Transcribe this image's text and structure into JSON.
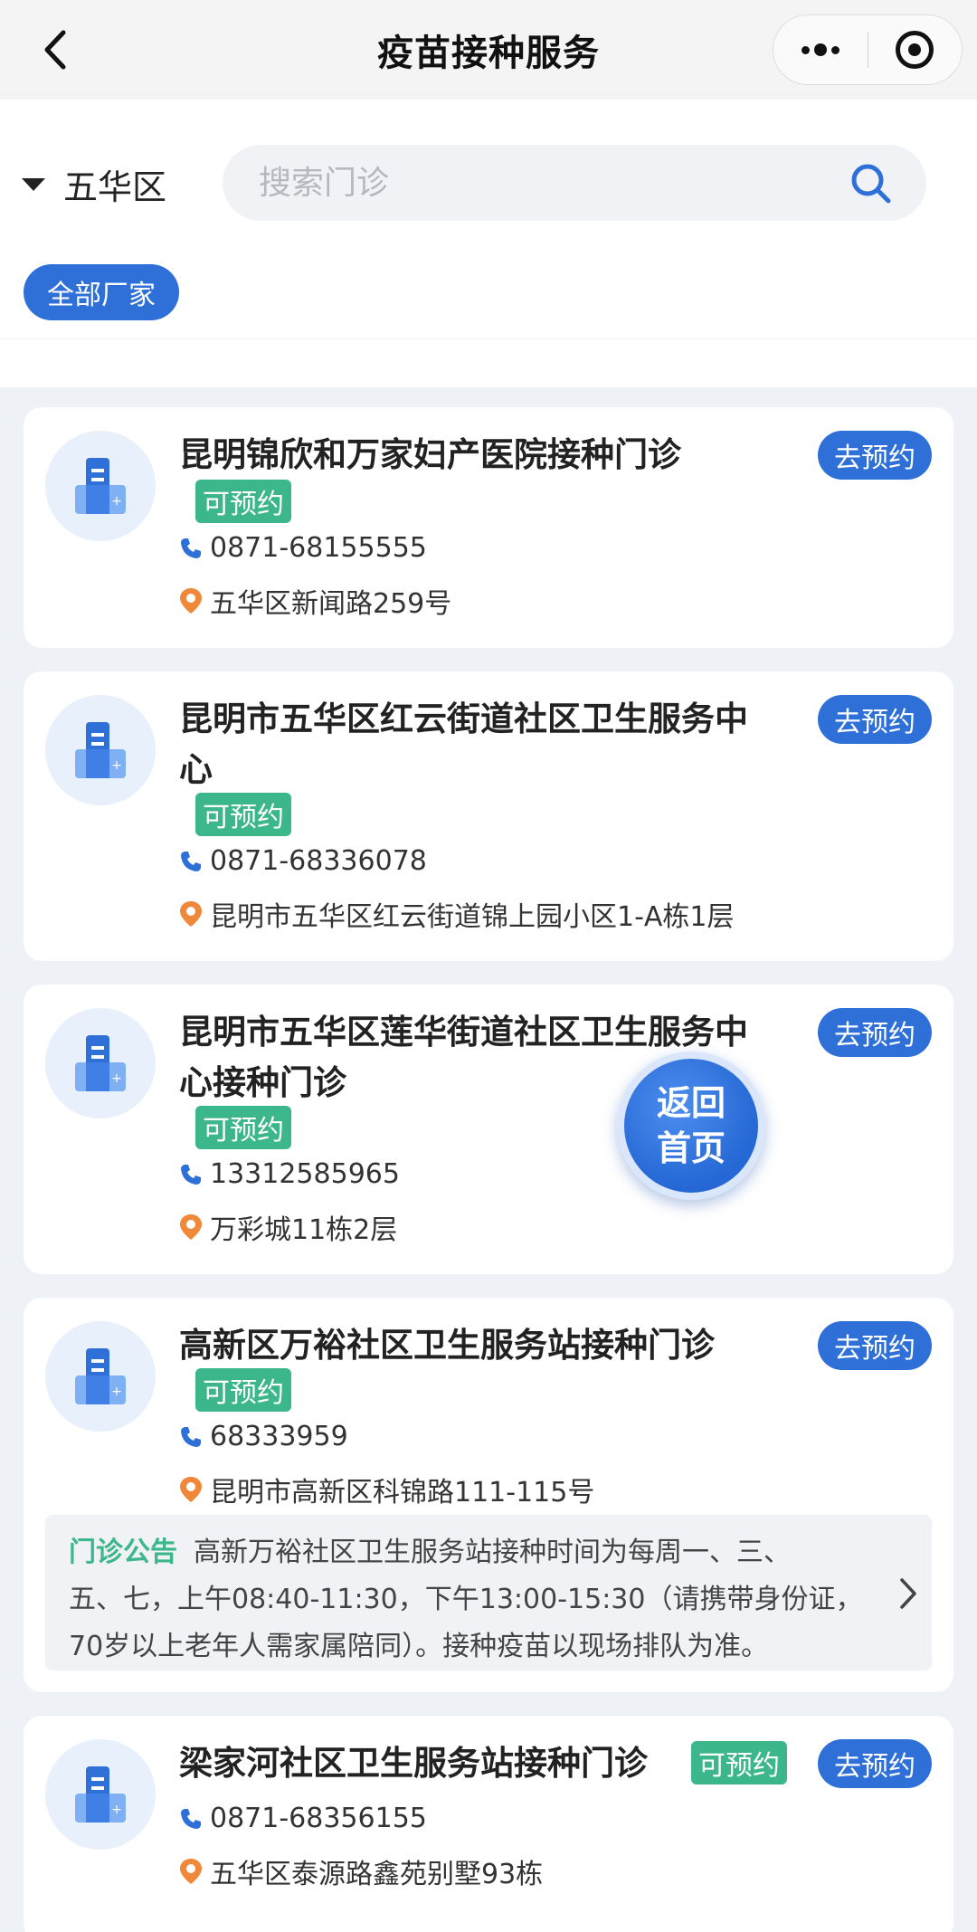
{
  "nav": {
    "title": "疫苗接种服务",
    "back_icon": "chevron-left-icon",
    "more_icon": "more-dots-icon",
    "close_icon": "target-circle-icon"
  },
  "filter": {
    "district": "五华区",
    "search_placeholder": "搜索门诊",
    "search_value": "",
    "vendor_chip": "全部厂家"
  },
  "colors": {
    "primary": "#2e6fd8",
    "available": "#3cb68b",
    "address_pin": "#f0883a"
  },
  "clinics": [
    {
      "name": "昆明锦欣和万家妇产医院接种门诊",
      "status": "可预约",
      "phone": "0871-68155555",
      "address": "五华区新闻路259号",
      "action": "去预约"
    },
    {
      "name_line1": "昆明市五华区红云街道社区卫生服务中",
      "name_line2": "心",
      "status": "可预约",
      "phone": "0871-68336078",
      "address": "昆明市五华区红云街道锦上园小区1-A栋1层",
      "action": "去预约"
    },
    {
      "name_line1": "昆明市五华区莲华街道社区卫生服务中",
      "name_line2": "心接种门诊",
      "status": "可预约",
      "phone": "13312585965",
      "address": "万彩城11栋2层",
      "action": "去预约"
    },
    {
      "name": "高新区万裕社区卫生服务站接种门诊",
      "status": "可预约",
      "phone": "68333959",
      "address": "昆明市高新区科锦路111-115号",
      "action": "去预约",
      "notice_label": "门诊公告",
      "notice_line1": "高新万裕社区卫生服务站接种时间为每周一、三、",
      "notice_line2": "五、七，上午08:40-11:30，下午13:00-15:30（请携带身份证，",
      "notice_line3": "70岁以上老年人需家属陪同）。接种疫苗以现场排队为准。"
    },
    {
      "name": "梁家河社区卫生服务站接种门诊",
      "status": "可预约",
      "phone": "0871-68356155",
      "address": "五华区泰源路鑫苑别墅93栋",
      "action": "去预约"
    }
  ],
  "home_fab": {
    "line1": "返回",
    "line2": "首页"
  }
}
